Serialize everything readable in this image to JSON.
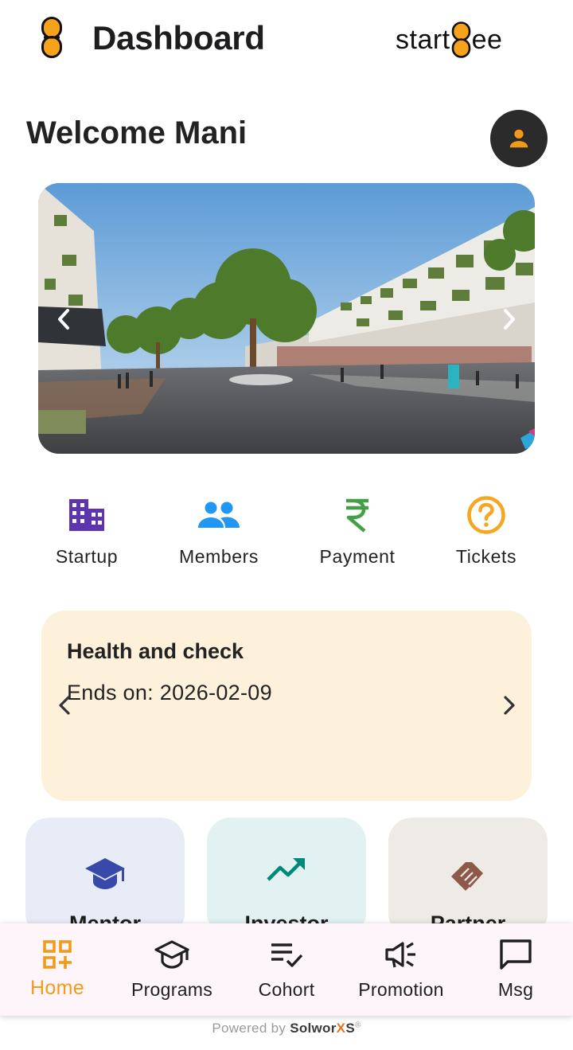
{
  "header": {
    "title": "Dashboard",
    "brand": {
      "prefix": "start",
      "suffix": "ee"
    }
  },
  "welcome": {
    "text": "Welcome Mani"
  },
  "icons": {
    "logo": "startbee-b-icon",
    "profile": "person-icon",
    "carousel_prev": "chevron-left-icon",
    "carousel_next": "chevron-right-icon"
  },
  "colors": {
    "accent": "#f29b18",
    "startup": "#5e35b1",
    "members": "#2196f3",
    "payment": "#43a047",
    "tickets": "#f5a623",
    "program_card_bg": "#fdf1dc",
    "mentor": "#3949ab",
    "investor": "#00897b",
    "partner": "#8d5a4a"
  },
  "quick_actions": [
    {
      "label": "Startup",
      "icon": "building-icon"
    },
    {
      "label": "Members",
      "icon": "people-icon"
    },
    {
      "label": "Payment",
      "icon": "rupee-icon"
    },
    {
      "label": "Tickets",
      "icon": "help-circle-icon"
    }
  ],
  "program": {
    "title": "Health and check",
    "ends": "Ends on: 2026-02-09"
  },
  "categories": [
    {
      "label": "Mentor",
      "icon": "graduation-cap-icon",
      "bg": "#e8ecf7"
    },
    {
      "label": "Investor",
      "icon": "trending-up-icon",
      "bg": "#e2f2f2"
    },
    {
      "label": "Partner",
      "icon": "handshake-icon",
      "bg": "#eeeae6"
    }
  ],
  "bottom_nav": [
    {
      "label": "Home",
      "icon": "dashboard-add-icon",
      "active": true
    },
    {
      "label": "Programs",
      "icon": "graduation-cap-icon"
    },
    {
      "label": "Cohort",
      "icon": "playlist-check-icon"
    },
    {
      "label": "Promotion",
      "icon": "campaign-icon"
    },
    {
      "label": "Msg",
      "icon": "chat-bubble-icon"
    }
  ],
  "footer": {
    "powered_by": "Powered by",
    "company_a": "Solwor",
    "company_x": "X",
    "company_b": "S",
    "reg": "®"
  }
}
